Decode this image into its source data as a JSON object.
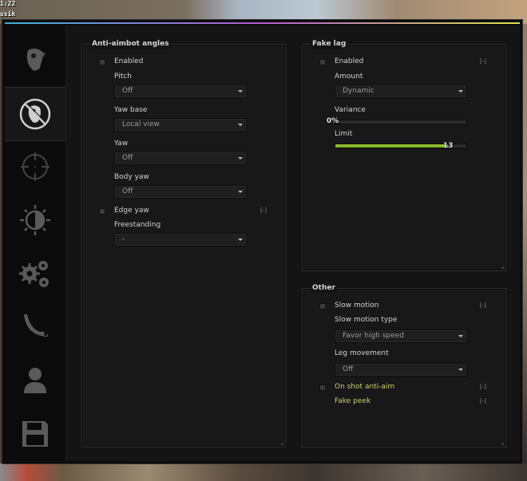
{
  "hud": {
    "time": "1:22",
    "name": "usik"
  },
  "tabs": [
    {
      "icon": "rage-head-icon"
    },
    {
      "icon": "anti-aim-icon",
      "active": true
    },
    {
      "icon": "crosshair-icon"
    },
    {
      "icon": "visuals-icon"
    },
    {
      "icon": "settings-gears-icon"
    },
    {
      "icon": "knife-icon"
    },
    {
      "icon": "player-icon"
    },
    {
      "icon": "save-icon"
    }
  ],
  "anti_aimbot": {
    "title": "Anti-aimbot angles",
    "enabled_label": "Enabled",
    "pitch_label": "Pitch",
    "pitch_value": "Off",
    "yaw_base_label": "Yaw base",
    "yaw_base_value": "Local view",
    "yaw_label": "Yaw",
    "yaw_value": "Off",
    "body_yaw_label": "Body yaw",
    "body_yaw_value": "Off",
    "edge_yaw_label": "Edge yaw",
    "edge_yaw_key": "[-]",
    "freestanding_label": "Freestanding",
    "freestanding_value": "-"
  },
  "fake_lag": {
    "title": "Fake lag",
    "enabled_label": "Enabled",
    "enabled_key": "[-]",
    "amount_label": "Amount",
    "amount_value": "Dynamic",
    "variance_label": "Variance",
    "variance_value": "0%",
    "variance_fraction": 0,
    "limit_label": "Limit",
    "limit_value": "13",
    "limit_fraction": 0.86
  },
  "other": {
    "title": "Other",
    "slow_motion_label": "Slow motion",
    "slow_motion_key": "[-]",
    "slow_motion_type_label": "Slow motion type",
    "slow_motion_type_value": "Favor high speed",
    "leg_movement_label": "Leg movement",
    "leg_movement_value": "Off",
    "on_shot_label": "On shot anti-aim",
    "on_shot_key": "[-]",
    "fake_peek_label": "Fake peek",
    "fake_peek_key": "[-]"
  },
  "colors": {
    "accent_green": "#a3d33b",
    "yellow_label": "#cdcf6c",
    "gradient": [
      "#3fb2d6",
      "#b55bd2",
      "#d8e249"
    ]
  }
}
